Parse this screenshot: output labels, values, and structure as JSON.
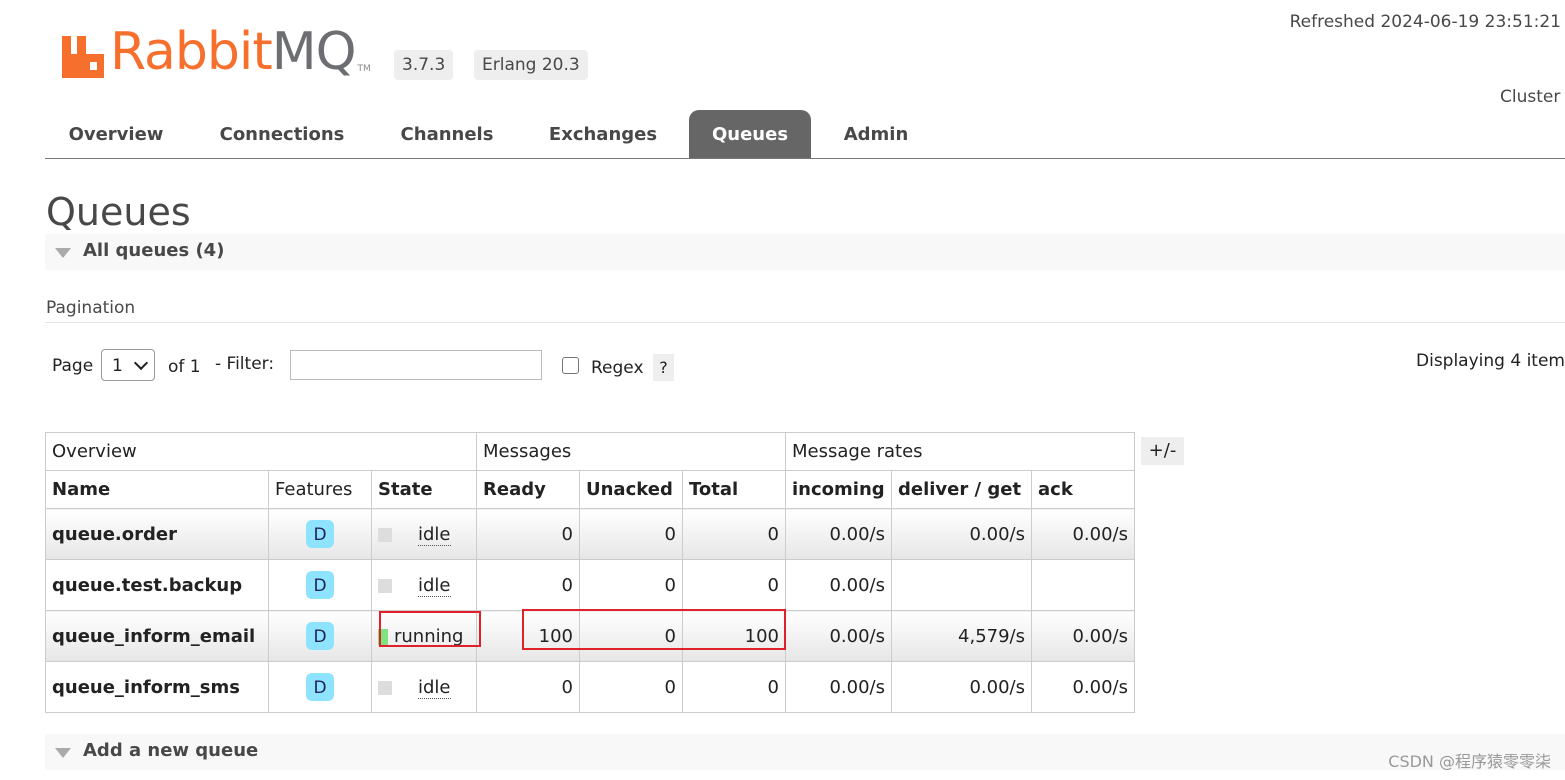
{
  "header": {
    "logo_rabbit": "Rabbit",
    "logo_mq": "MQ",
    "logo_tm": "TM",
    "version": "3.7.3",
    "erlang": "Erlang 20.3",
    "refreshed": "Refreshed 2024-06-19 23:51:21",
    "cluster": "Cluster"
  },
  "tabs": [
    "Overview",
    "Connections",
    "Channels",
    "Exchanges",
    "Queues",
    "Admin"
  ],
  "active_tab": "Queues",
  "page_title": "Queues",
  "all_queues_label": "All queues (4)",
  "pagination": {
    "label": "Pagination",
    "page_label": "Page",
    "page_value": "1",
    "of_label": "of 1",
    "filter_label": "- Filter:",
    "filter_value": "",
    "regex_label": "Regex",
    "help": "?",
    "displaying": "Displaying 4 item"
  },
  "table": {
    "groups": [
      "Overview",
      "Messages",
      "Message rates"
    ],
    "columns": [
      "Name",
      "Features",
      "State",
      "Ready",
      "Unacked",
      "Total",
      "incoming",
      "deliver / get",
      "ack"
    ],
    "plus_minus": "+/-",
    "rows": [
      {
        "name": "queue.order",
        "feature": "D",
        "state": "idle",
        "ready": "0",
        "unacked": "0",
        "total": "0",
        "incoming": "0.00/s",
        "deliver": "0.00/s",
        "ack": "0.00/s"
      },
      {
        "name": "queue.test.backup",
        "feature": "D",
        "state": "idle",
        "ready": "0",
        "unacked": "0",
        "total": "0",
        "incoming": "0.00/s",
        "deliver": "",
        "ack": ""
      },
      {
        "name": "queue_inform_email",
        "feature": "D",
        "state": "running",
        "ready": "100",
        "unacked": "0",
        "total": "100",
        "incoming": "0.00/s",
        "deliver": "4,579/s",
        "ack": "0.00/s"
      },
      {
        "name": "queue_inform_sms",
        "feature": "D",
        "state": "idle",
        "ready": "0",
        "unacked": "0",
        "total": "0",
        "incoming": "0.00/s",
        "deliver": "0.00/s",
        "ack": "0.00/s"
      }
    ]
  },
  "add_queue_label": "Add a new queue",
  "watermark": "CSDN @程序猿零零柒",
  "colors": {
    "brand": "#f76f2c",
    "tab_active": "#666666",
    "highlight": "#e0202a",
    "running": "#7fe37f",
    "feature_badge": "#8ee3ff"
  }
}
